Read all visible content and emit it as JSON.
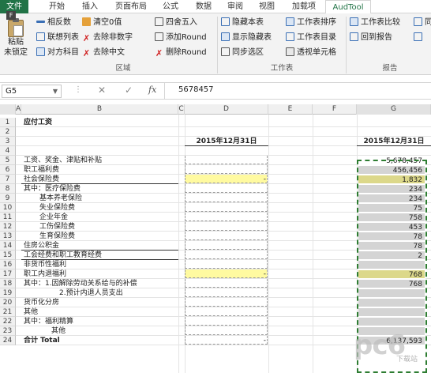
{
  "ribbon_tabs": [
    "文件",
    "开始",
    "插入",
    "页面布局",
    "公式",
    "数据",
    "审阅",
    "视图",
    "加载项",
    "AudTool"
  ],
  "file_key_tip": "F",
  "paste": {
    "line1": "粘贴",
    "line2": "未锁定"
  },
  "buttons": {
    "reverse_sign": "相反数",
    "link_list": "联想列表",
    "cross_ref": "对方科目",
    "clear_zero": "清空0值",
    "remove_non_digit": "去除非数字",
    "remove_chinese": "去除中文",
    "round": "四舍五入",
    "add_round": "添加Round",
    "delete_round": "删除Round",
    "hide_sheet": "隐藏本表",
    "show_hidden": "显示隐藏表",
    "sync_select": "同步选区",
    "sheet_sort": "工作表排序",
    "sheet_dir": "工作表目录",
    "pivot": "透视单元格",
    "sheet_compare": "工作表比较",
    "back_report": "回到报告",
    "next_partial": "同"
  },
  "groups": {
    "area": "区域",
    "sheet": "工作表",
    "report": "报告"
  },
  "formula_bar": {
    "name_box": "G5",
    "fx": "fx",
    "value": "5678457"
  },
  "columns": [
    "A",
    "B",
    "C",
    "D",
    "E",
    "F",
    "G"
  ],
  "rows": [
    {
      "n": "1",
      "b": "应付工资",
      "d": "",
      "g": ""
    },
    {
      "n": "2",
      "b": "",
      "d": "",
      "g": ""
    },
    {
      "n": "3",
      "b": "",
      "d": "2015年12月31日",
      "g": "2015年12月31日"
    },
    {
      "n": "4",
      "b": "",
      "d": "",
      "g": ""
    },
    {
      "n": "5",
      "b": "工资、奖金、津贴和补贴",
      "d": "",
      "g": "5,678,457"
    },
    {
      "n": "6",
      "b": "职工福利费",
      "d": "",
      "g": "456,456"
    },
    {
      "n": "7",
      "b": "社会保险费",
      "d": "-",
      "g": "1,832"
    },
    {
      "n": "8",
      "b": "其中：医疗保险费",
      "d": "",
      "g": "234"
    },
    {
      "n": "9",
      "b": "基本养老保险",
      "d": "",
      "g": "234"
    },
    {
      "n": "10",
      "b": "失业保险费",
      "d": "",
      "g": "75"
    },
    {
      "n": "11",
      "b": "企业年金",
      "d": "",
      "g": "758"
    },
    {
      "n": "12",
      "b": "工伤保险费",
      "d": "",
      "g": "453"
    },
    {
      "n": "13",
      "b": "生育保险费",
      "d": "",
      "g": "78"
    },
    {
      "n": "14",
      "b": "住房公积金",
      "d": "",
      "g": "78"
    },
    {
      "n": "15",
      "b": "工会经费和职工教育经费",
      "d": "",
      "g": "2"
    },
    {
      "n": "16",
      "b": "非货币性福利",
      "d": "",
      "g": ""
    },
    {
      "n": "17",
      "b": "职工内退福利",
      "d": "-",
      "g": "768"
    },
    {
      "n": "18",
      "b": "其中：1.因解除劳动关系给与的补偿",
      "d": "",
      "g": "768"
    },
    {
      "n": "19",
      "b": "2.预计内退人员支出",
      "d": "",
      "g": ""
    },
    {
      "n": "20",
      "b": "货币化分房",
      "d": "",
      "g": ""
    },
    {
      "n": "21",
      "b": "其他",
      "d": "",
      "g": ""
    },
    {
      "n": "22",
      "b": "其中：福利精算",
      "d": "",
      "g": ""
    },
    {
      "n": "23",
      "b": "其他",
      "d": "",
      "g": ""
    },
    {
      "n": "24",
      "b": "合计 Total",
      "d": "-",
      "g": "6,137,593"
    }
  ],
  "watermark": {
    "main": "pc6",
    "sub": "下载站"
  },
  "colors": {
    "excel_green": "#217346",
    "highlight_yellow": "#fffaa0",
    "selection_gray": "#d4d4d4",
    "selection_border": "#2e7d32"
  }
}
